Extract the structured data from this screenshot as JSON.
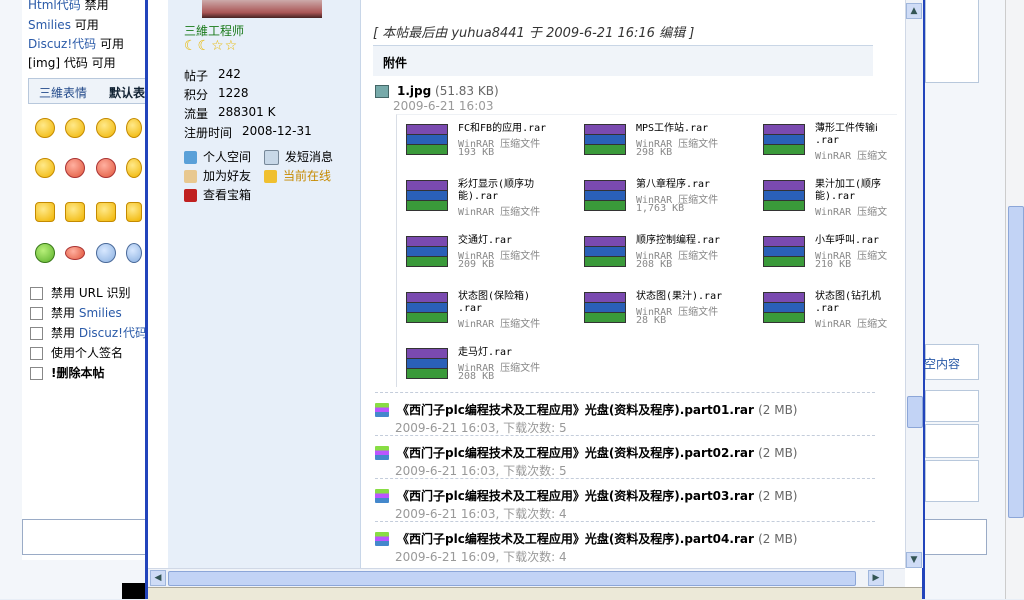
{
  "background_form": {
    "top_lines": [
      {
        "link": "Html代码",
        "text": "禁用"
      },
      {
        "link": "Smilies",
        "text": "可用"
      },
      {
        "link": "Discuz!代码",
        "text": "可用"
      },
      {
        "link": "[img] 代码",
        "text": "可用"
      }
    ],
    "tabs": [
      "三維表情",
      "默认表"
    ],
    "options": [
      {
        "prefix": "禁用",
        "label": "URL 识别"
      },
      {
        "prefix": "禁用",
        "label": "Smilies"
      },
      {
        "prefix": "禁用",
        "label": "Discuz!代码"
      },
      {
        "prefix": "",
        "label": "使用个人签名"
      },
      {
        "prefix": "",
        "label": "!删除本帖"
      }
    ],
    "right_text": "空内容"
  },
  "author": {
    "title": "三維工程师",
    "stars": "☾☾☆☆",
    "stats": [
      {
        "label": "帖子",
        "value": "242"
      },
      {
        "label": "积分",
        "value": "1228"
      },
      {
        "label": "流量",
        "value": "288301 K"
      },
      {
        "label": "注册时间",
        "value": "2008-12-31"
      }
    ],
    "actions": [
      "个人空间",
      "发短消息",
      "加为好友",
      "当前在线",
      "查看宝箱"
    ]
  },
  "post": {
    "edited": "[ 本帖最后由 yuhua8441 于 2009-6-21 16:16 编辑 ]",
    "attach_header": "附件",
    "image_file": {
      "name": "1.jpg",
      "size": "(51.83 KB)",
      "date": "2009-6-21 16:03"
    },
    "rar_files": [
      {
        "name": "FC和FB的应用.rar",
        "type": "WinRAR 压缩文件",
        "size": "193 KB"
      },
      {
        "name": "MPS工作站.rar",
        "type": "WinRAR 压缩文件",
        "size": "298 KB"
      },
      {
        "name": "薄形工件传输ⅰ\n.rar",
        "type": "WinRAR 压缩文",
        "size": ""
      },
      {
        "name": "彩灯显示(顺序功\n能).rar",
        "type": "WinRAR 压缩文件",
        "size": ""
      },
      {
        "name": "第八章程序.rar",
        "type": "WinRAR 压缩文件",
        "size": "1,763 KB"
      },
      {
        "name": "果汁加工(顺序\n能).rar",
        "type": "WinRAR 压缩文",
        "size": ""
      },
      {
        "name": "交通灯.rar",
        "type": "WinRAR 压缩文件",
        "size": "209 KB"
      },
      {
        "name": "顺序控制编程.rar",
        "type": "WinRAR 压缩文件",
        "size": "208 KB"
      },
      {
        "name": "小车呼叫.rar",
        "type": "WinRAR 压缩文",
        "size": "210 KB"
      },
      {
        "name": "状态图(保险箱)\n.rar",
        "type": "WinRAR 压缩文件",
        "size": ""
      },
      {
        "name": "状态图(果汁).rar",
        "type": "WinRAR 压缩文件",
        "size": "28 KB"
      },
      {
        "name": "状态图(钻孔机\n.rar",
        "type": "WinRAR 压缩文",
        "size": ""
      },
      {
        "name": "走马灯.rar",
        "type": "WinRAR 压缩文件",
        "size": "208 KB"
      }
    ],
    "parts": [
      {
        "name": "《西门子plc编程技术及工程应用》光盘(资料及程序).part01.rar",
        "size": "(2 MB)",
        "meta": "2009-6-21 16:03, 下载次数: 5"
      },
      {
        "name": "《西门子plc编程技术及工程应用》光盘(资料及程序).part02.rar",
        "size": "(2 MB)",
        "meta": "2009-6-21 16:03, 下载次数: 5"
      },
      {
        "name": "《西门子plc编程技术及工程应用》光盘(资料及程序).part03.rar",
        "size": "(2 MB)",
        "meta": "2009-6-21 16:03, 下载次数: 4"
      },
      {
        "name": "《西门子plc编程技术及工程应用》光盘(资料及程序).part04.rar",
        "size": "(2 MB)",
        "meta": "2009-6-21 16:09, 下载次数: 4"
      }
    ]
  },
  "colors": {
    "frame": "#2244bb",
    "author_bg": "#e7eff9",
    "link": "#2a5aa8"
  }
}
